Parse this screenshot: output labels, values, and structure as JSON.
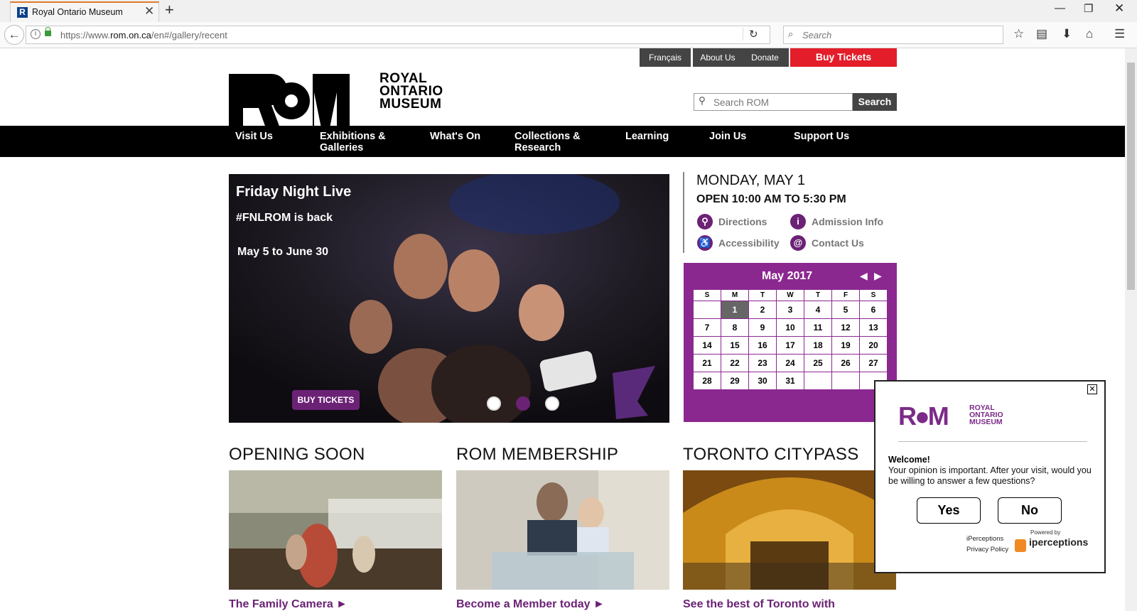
{
  "browser": {
    "tab_title": "Royal Ontario Museum",
    "favicon_letter": "R",
    "url_prefix": "https://www.",
    "url_host": "rom.on.ca",
    "url_path": "/en#/gallery/recent",
    "search_placeholder": "Search"
  },
  "header": {
    "top_links": [
      "Français",
      "About Us",
      "Donate"
    ],
    "buy_tickets": "Buy Tickets",
    "logo_text": [
      "ROYAL",
      "ONTARIO",
      "MUSEUM"
    ],
    "search_placeholder": "Search ROM",
    "search_button": "Search"
  },
  "nav": [
    "Visit Us",
    "Exhibitions & Galleries",
    "What's On",
    "Collections & Research",
    "Learning",
    "Join Us",
    "Support Us"
  ],
  "hero": {
    "title": "Friday Night Live",
    "subtitle": "#FNLROM is back",
    "dates": "May 5 to June 30",
    "buy_button": "BUY TICKETS",
    "active_slide": 2,
    "slide_count": 3
  },
  "hours": {
    "date": "MONDAY, MAY 1",
    "open": "OPEN 10:00 AM TO 5:30 PM",
    "links": [
      {
        "label": "Directions",
        "icon": "map-pin-icon"
      },
      {
        "label": "Admission Info",
        "icon": "info-icon"
      },
      {
        "label": "Accessibility",
        "icon": "wheelchair-icon"
      },
      {
        "label": "Contact Us",
        "icon": "at-sign-icon"
      }
    ]
  },
  "calendar": {
    "title": "May 2017",
    "days": [
      "S",
      "M",
      "T",
      "W",
      "T",
      "F",
      "S"
    ],
    "weeks": [
      [
        "",
        "1",
        "2",
        "3",
        "4",
        "5",
        "6"
      ],
      [
        "7",
        "8",
        "9",
        "10",
        "11",
        "12",
        "13"
      ],
      [
        "14",
        "15",
        "16",
        "17",
        "18",
        "19",
        "20"
      ],
      [
        "21",
        "22",
        "23",
        "24",
        "25",
        "26",
        "27"
      ],
      [
        "28",
        "29",
        "30",
        "31",
        "",
        "",
        ""
      ]
    ],
    "today": "1"
  },
  "sections": [
    {
      "title": "OPENING SOON",
      "link": "The Family Camera ►"
    },
    {
      "title": "ROM MEMBERSHIP",
      "link": "Become a Member today ►"
    },
    {
      "title": "TORONTO CITYPASS",
      "link": "See the best of Toronto with"
    }
  ],
  "survey": {
    "logo_mark": "R●M",
    "logo_text": [
      "ROYAL",
      "ONTARIO",
      "MUSEUM"
    ],
    "welcome": "Welcome!",
    "question": "Your opinion is important. After your visit, would you be willing to answer a few questions?",
    "yes": "Yes",
    "no": "No",
    "privacy": [
      "iPerceptions",
      "Privacy Policy"
    ],
    "powered_by": "Powered by",
    "brand": "iperceptions"
  },
  "colors": {
    "brand_purple": "#6b2275",
    "buy_red": "#e31d29"
  }
}
